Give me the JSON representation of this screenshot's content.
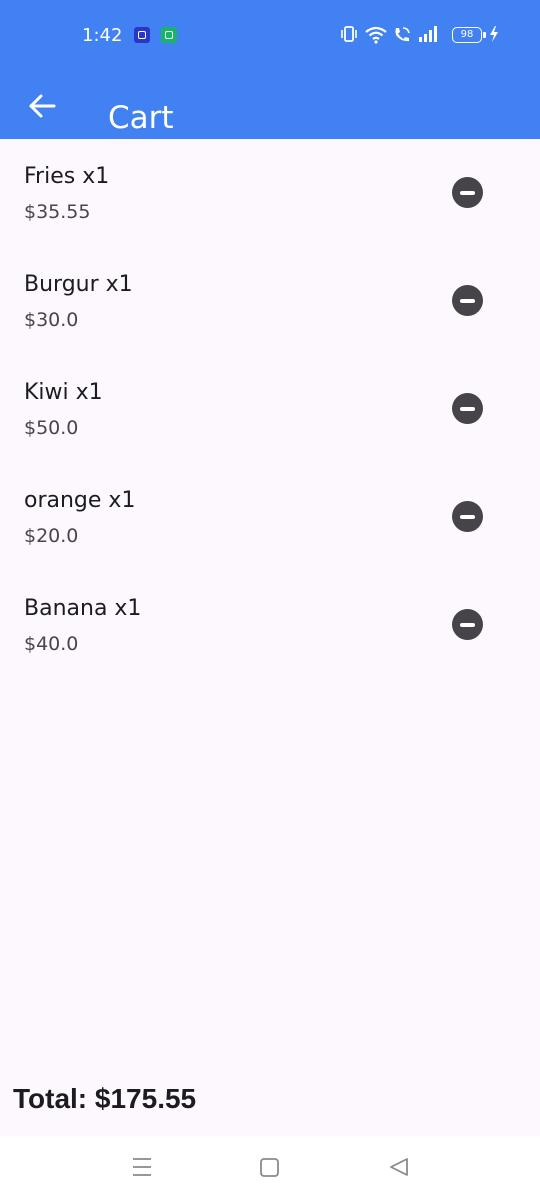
{
  "status_bar": {
    "time": "1:42",
    "battery_level": "98",
    "icons": [
      "app-notification-icon",
      "app-notification-icon",
      "vibrate-icon",
      "wifi-icon",
      "wifi-call-icon",
      "signal-icon",
      "battery-icon",
      "charging-icon"
    ]
  },
  "app_bar": {
    "back_icon": "arrow-back-icon",
    "title": "Cart"
  },
  "cart": {
    "items": [
      {
        "name": "Fries x1",
        "price": "$35.55"
      },
      {
        "name": "Burgur x1",
        "price": "$30.0"
      },
      {
        "name": "Kiwi x1",
        "price": "$50.0"
      },
      {
        "name": "orange x1",
        "price": "$20.0"
      },
      {
        "name": "Banana x1",
        "price": "$40.0"
      }
    ],
    "remove_icon": "remove-circle-icon"
  },
  "total": "Total: $175.55",
  "nav_bar": {
    "icons": [
      "menu-icon",
      "home-icon",
      "back-triangle-icon"
    ]
  },
  "colors": {
    "primary": "#4281f2",
    "background": "#fdf8fd",
    "icon_dark": "#46434a"
  }
}
